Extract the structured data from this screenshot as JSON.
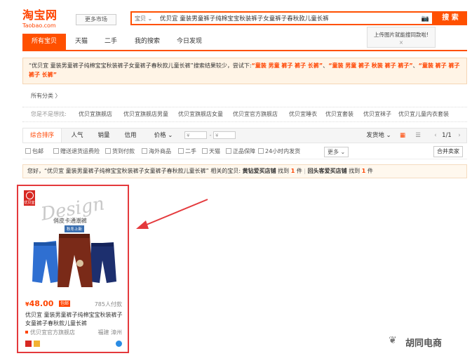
{
  "header": {
    "logo_cn": "淘宝网",
    "logo_en": "Taobao.com",
    "market_button": "更多市场",
    "search_scope": "宝贝 ⌄",
    "search_query": "优贝宜 童装男童裤子纯棉宝宝秋装裤子女童裤子春秋款儿童长裤",
    "search_button": "搜 索",
    "tooltip_text": "上传图片就能搜同款啦!",
    "tooltip_close": "×"
  },
  "tabs": [
    "所有宝贝",
    "天猫",
    "二手",
    "我的搜索",
    "今日发现"
  ],
  "suggestion": {
    "prefix": "“优贝宜 童装男童裤子纯棉宝宝秋装裤子女童裤子春秋款儿童长裤”搜索结果较少，尝试下:",
    "options": [
      "“童装 男童 裤子 裤子 长裤”",
      "“童装 男童 裤子 秋装 裤子 裤子”",
      "“童装 裤子 裤子 裤子 长裤”"
    ]
  },
  "categories": {
    "all_label": "所有分类 〉",
    "guess_label": "您是不是想找:",
    "guesses": [
      "优贝宜旗舰店",
      "优贝宜旗舰店男童",
      "优贝宜旗舰店女童",
      "优贝宜官方旗舰店",
      "优贝宜睡衣",
      "优贝宜套装",
      "优贝宜袜子",
      "优贝宜儿童内衣套装"
    ]
  },
  "sortbar": {
    "items": [
      "综合排序",
      "人气",
      "销量",
      "信用",
      "价格 ⌄"
    ],
    "price_from": "¥",
    "price_sep": "-",
    "price_to": "¥",
    "shipping": "发货地 ⌄",
    "page": "1/1",
    "prev": "‹",
    "next": "›"
  },
  "filters": {
    "options": [
      "包邮",
      "赠送退货运费险",
      "货到付款",
      "海外商品",
      "二手",
      "天猫",
      "正品保障",
      "24小时内发货"
    ],
    "more": "更多 ⌄",
    "merge": "合并卖家"
  },
  "hint": {
    "prefix": "您好，“优贝宜 童装男童裤子纯棉宝宝秋装裤子女童裤子春秋款儿童长裤” 相关的宝贝:",
    "shop1": "黄钻爱买店铺",
    "found": "找到",
    "count1": "1",
    "unit": "件",
    "sep": "|",
    "shop2": "回头客爱买店铺",
    "count2": "1"
  },
  "product": {
    "badge": "优贝宜",
    "watermark": "Design",
    "promo1": "俏皮卡通潮裤",
    "promo2": "秋冬上新",
    "currency": "¥",
    "price": "48.00",
    "discount": "包邮",
    "sold": "785人付款",
    "title": "优贝宜 童装男童裤子纯棉宝宝秋装裤子女童裤子春秋款儿童长裤",
    "shop": "优贝宜官方旗舰店",
    "location": "福建 漳州"
  },
  "watermark": {
    "icon": "❦",
    "text": "胡同电商"
  },
  "colors": {
    "accent": "#ff5000",
    "price": "#ff4400",
    "highlight_border": "#e4393c"
  }
}
